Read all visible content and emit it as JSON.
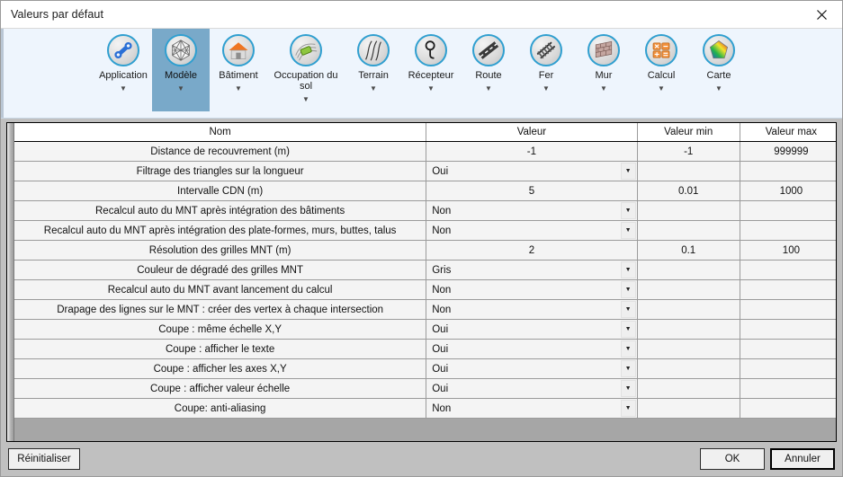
{
  "window": {
    "title": "Valeurs par défaut",
    "close_icon": "close-icon"
  },
  "ribbon": {
    "items": [
      {
        "label": "Application",
        "icon": "wrench-icon",
        "selected": false,
        "caret": "▼",
        "wide": false
      },
      {
        "label": "Modèle",
        "icon": "mesh-sphere-icon",
        "selected": true,
        "caret": "▼",
        "wide": false
      },
      {
        "label": "Bâtiment",
        "icon": "building-icon",
        "selected": false,
        "caret": "▼",
        "wide": false
      },
      {
        "label": "Occupation du\nsol",
        "icon": "land-use-icon",
        "selected": false,
        "caret": "▼",
        "wide": true
      },
      {
        "label": "Terrain",
        "icon": "terrain-icon",
        "selected": false,
        "caret": "▼",
        "wide": false
      },
      {
        "label": "Récepteur",
        "icon": "receiver-icon",
        "selected": false,
        "caret": "▼",
        "wide": false
      },
      {
        "label": "Route",
        "icon": "road-icon",
        "selected": false,
        "caret": "▼",
        "wide": false
      },
      {
        "label": "Fer",
        "icon": "rail-icon",
        "selected": false,
        "caret": "▼",
        "wide": false
      },
      {
        "label": "Mur",
        "icon": "wall-icon",
        "selected": false,
        "caret": "▼",
        "wide": false
      },
      {
        "label": "Calcul",
        "icon": "calculator-icon",
        "selected": false,
        "caret": "▼",
        "wide": false
      },
      {
        "label": "Carte",
        "icon": "colormap-icon",
        "selected": false,
        "caret": "▼",
        "wide": false
      }
    ]
  },
  "grid": {
    "columns": [
      "Nom",
      "Valeur",
      "Valeur min",
      "Valeur max"
    ],
    "rows": [
      {
        "name": "Distance de recouvrement (m)",
        "value": "-1",
        "kind": "number",
        "min": "-1",
        "max": "999999"
      },
      {
        "name": "Filtrage des triangles sur la longueur",
        "value": "Oui",
        "kind": "combo",
        "min": "",
        "max": ""
      },
      {
        "name": "Intervalle CDN (m)",
        "value": "5",
        "kind": "number",
        "min": "0.01",
        "max": "1000"
      },
      {
        "name": "Recalcul auto du MNT après intégration des bâtiments",
        "value": "Non",
        "kind": "combo",
        "min": "",
        "max": ""
      },
      {
        "name": "Recalcul auto du MNT après intégration des plate-formes, murs, buttes, talus",
        "value": "Non",
        "kind": "combo",
        "min": "",
        "max": ""
      },
      {
        "name": "Résolution des grilles MNT (m)",
        "value": "2",
        "kind": "number",
        "min": "0.1",
        "max": "100"
      },
      {
        "name": "Couleur de dégradé des grilles MNT",
        "value": "Gris",
        "kind": "combo",
        "min": "",
        "max": ""
      },
      {
        "name": "Recalcul auto du MNT avant lancement du calcul",
        "value": "Non",
        "kind": "combo",
        "min": "",
        "max": ""
      },
      {
        "name": "Drapage des lignes sur le MNT : créer des vertex à chaque intersection",
        "value": "Non",
        "kind": "combo",
        "min": "",
        "max": ""
      },
      {
        "name": "Coupe : même échelle X,Y",
        "value": "Oui",
        "kind": "combo",
        "min": "",
        "max": ""
      },
      {
        "name": "Coupe : afficher le texte",
        "value": "Oui",
        "kind": "combo",
        "min": "",
        "max": ""
      },
      {
        "name": "Coupe : afficher les axes X,Y",
        "value": "Oui",
        "kind": "combo",
        "min": "",
        "max": ""
      },
      {
        "name": "Coupe : afficher valeur échelle",
        "value": "Oui",
        "kind": "combo",
        "min": "",
        "max": ""
      },
      {
        "name": "Coupe: anti-aliasing",
        "value": "Non",
        "kind": "combo",
        "min": "",
        "max": ""
      }
    ],
    "dropdown_arrow": "▼"
  },
  "footer": {
    "reset_label": "Réinitialiser",
    "ok_label": "OK",
    "cancel_label": "Annuler"
  },
  "colors": {
    "ribbon_bg": "#eef5fd",
    "ribbon_selected": "#79a9c9",
    "name_text": "#107c10",
    "icon_ring": "#2f9fd0",
    "dialog_bg": "#c0c0c0",
    "grid_row_bg": "#f4f4f4",
    "grid_filler": "#a6a6a6"
  }
}
